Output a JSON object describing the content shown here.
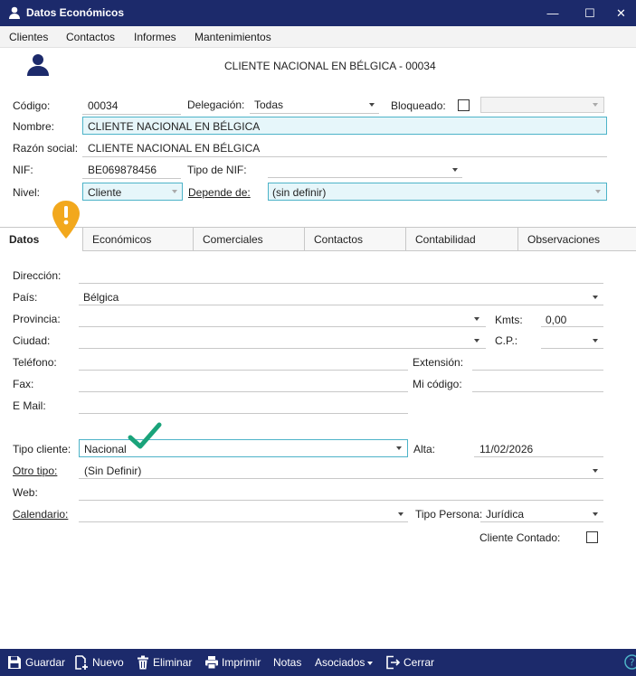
{
  "window": {
    "title": "Datos Económicos",
    "minimize": "—",
    "maximize": "☐",
    "close": "✕"
  },
  "menu": [
    "Clientes",
    "Contactos",
    "Informes",
    "Mantenimientos"
  ],
  "header": {
    "heading": "CLIENTE NACIONAL EN BÉLGICA - 00034"
  },
  "top_form": {
    "codigo_label": "Código:",
    "codigo_value": "00034",
    "delegacion_label": "Delegación:",
    "delegacion_value": "Todas",
    "bloqueado_label": "Bloqueado:",
    "nombre_label": "Nombre:",
    "nombre_value": "CLIENTE NACIONAL EN BÉLGICA",
    "razon_label": "Razón social:",
    "razon_value": "CLIENTE NACIONAL EN BÉLGICA",
    "nif_label": "NIF:",
    "nif_value": "BE069878456",
    "tipo_nif_label": "Tipo de NIF:",
    "tipo_nif_value": "",
    "nivel_label": "Nivel:",
    "nivel_value": "Cliente",
    "depende_label": "Depende de:",
    "depende_value": "(sin definir)"
  },
  "tabs": [
    "Datos",
    "Económicos",
    "Comerciales",
    "Contactos",
    "Contabilidad",
    "Observaciones"
  ],
  "datos": {
    "direccion_label": "Dirección:",
    "pais_label": "País:",
    "pais_value": "Bélgica",
    "provincia_label": "Provincia:",
    "kmts_label": "Kmts:",
    "kmts_value": "0,00",
    "ciudad_label": "Ciudad:",
    "cp_label": "C.P.:",
    "telefono_label": "Teléfono:",
    "extension_label": "Extensión:",
    "fax_label": "Fax:",
    "mi_codigo_label": "Mi código:",
    "email_label": "E Mail:",
    "tipo_cliente_label": "Tipo cliente:",
    "tipo_cliente_value": "Nacional",
    "alta_label": "Alta:",
    "alta_value": "11/02/2026",
    "otro_tipo_label": "Otro tipo:",
    "otro_tipo_value": "(Sin Definir)",
    "web_label": "Web:",
    "calendario_label": "Calendario:",
    "tipo_persona_label": "Tipo Persona:",
    "tipo_persona_value": "Jurídica",
    "cliente_contado_label": "Cliente Contado:"
  },
  "footer": {
    "guardar": "Guardar",
    "nuevo": "Nuevo",
    "eliminar": "Eliminar",
    "imprimir": "Imprimir",
    "notas": "Notas",
    "asociados": "Asociados",
    "cerrar": "Cerrar"
  },
  "colors": {
    "titlebar": "#1c2a6b",
    "accent_border": "#4db3c8",
    "warning_badge": "#f2a81d",
    "check_mark": "#1aa37a"
  }
}
